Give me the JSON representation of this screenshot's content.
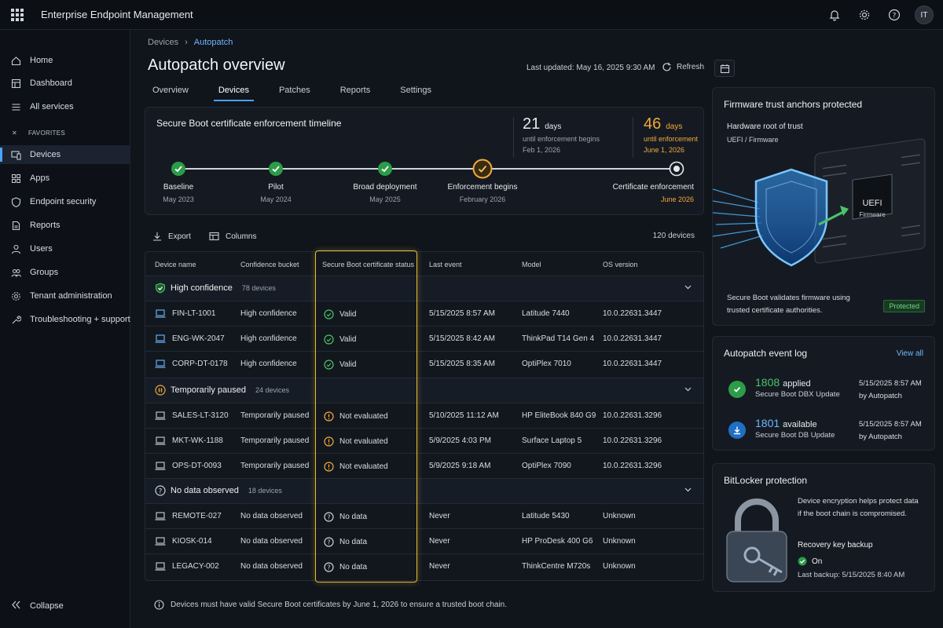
{
  "app": {
    "title": "Enterprise Endpoint Management",
    "avatar_initials": "IT"
  },
  "sidebar": {
    "items": [
      {
        "label": "Home",
        "icon": "home-icon"
      },
      {
        "label": "Dashboard",
        "icon": "dashboard-icon"
      },
      {
        "label": "All services",
        "icon": "list-icon"
      },
      {
        "label": "Devices",
        "icon": "devices-icon",
        "active": true
      },
      {
        "label": "Apps",
        "icon": "apps-icon"
      },
      {
        "label": "Endpoint security",
        "icon": "shield-icon"
      },
      {
        "label": "Reports",
        "icon": "reports-icon"
      },
      {
        "label": "Users",
        "icon": "user-icon"
      },
      {
        "label": "Groups",
        "icon": "groups-icon"
      },
      {
        "label": "Tenant administration",
        "icon": "gear-icon"
      },
      {
        "label": "Troubleshooting + support",
        "icon": "wrench-icon"
      }
    ],
    "favorites_label": "FAVORITES",
    "collapse_label": "Collapse"
  },
  "header": {
    "breadcrumb": [
      "Devices",
      "Autopatch"
    ],
    "title": "Autopatch overview",
    "last_updated": "Last updated: May 16, 2025 9:30 AM",
    "refresh_label": "Refresh",
    "tabs": [
      "Overview",
      "Devices",
      "Patches",
      "Reports",
      "Settings"
    ],
    "active_tab": "Devices"
  },
  "timeline": {
    "title": "Secure Boot certificate enforcement timeline",
    "counter1": {
      "number": "21",
      "unit": "days",
      "line1": "until enforcement begins",
      "line2": "Feb 1, 2026"
    },
    "counter2": {
      "number": "46",
      "unit": "days",
      "line1": "until enforcement",
      "line2": "June 1, 2026"
    },
    "milestones": [
      {
        "label": "Baseline",
        "date": "May 2023",
        "state": "done"
      },
      {
        "label": "Pilot",
        "date": "May 2024",
        "state": "done"
      },
      {
        "label": "Broad deployment",
        "date": "May 2025",
        "state": "done"
      },
      {
        "label": "Enforcement begins",
        "date": "February 2026",
        "state": "current"
      },
      {
        "label": "Certificate enforcement",
        "date": "June 2026",
        "state": "final"
      }
    ]
  },
  "toolbar": {
    "export_label": "Export",
    "columns_label": "Columns",
    "device_count": "120 devices"
  },
  "table": {
    "headers": [
      "Device name",
      "Confidence bucket",
      "Secure Boot certificate status",
      "Last event",
      "Model",
      "OS version"
    ],
    "groups": [
      {
        "title": "High confidence",
        "count": "78 devices",
        "icon": "shield-check-icon",
        "rows": [
          {
            "name": "FIN-LT-1001",
            "bucket": "High confidence",
            "status": "Valid",
            "event": "5/15/2025 8:57 AM",
            "model": "Latitude 7440",
            "os": "10.0.22631.3447"
          },
          {
            "name": "ENG-WK-2047",
            "bucket": "High confidence",
            "status": "Valid",
            "event": "5/15/2025 8:42 AM",
            "model": "ThinkPad T14 Gen 4",
            "os": "10.0.22631.3447"
          },
          {
            "name": "CORP-DT-0178",
            "bucket": "High confidence",
            "status": "Valid",
            "event": "5/15/2025 8:35 AM",
            "model": "OptiPlex 7010",
            "os": "10.0.22631.3447"
          }
        ]
      },
      {
        "title": "Temporarily paused",
        "count": "24 devices",
        "icon": "pause-icon",
        "rows": [
          {
            "name": "SALES-LT-3120",
            "bucket": "Temporarily paused",
            "status": "Not evaluated",
            "event": "5/10/2025 11:12 AM",
            "model": "HP EliteBook 840 G9",
            "os": "10.0.22631.3296"
          },
          {
            "name": "MKT-WK-1188",
            "bucket": "Temporarily paused",
            "status": "Not evaluated",
            "event": "5/9/2025 4:03 PM",
            "model": "Surface Laptop 5",
            "os": "10.0.22631.3296"
          },
          {
            "name": "OPS-DT-0093",
            "bucket": "Temporarily paused",
            "status": "Not evaluated",
            "event": "5/9/2025 9:18 AM",
            "model": "OptiPlex 7090",
            "os": "10.0.22631.3296"
          }
        ]
      },
      {
        "title": "No data observed",
        "count": "18 devices",
        "icon": "question-icon",
        "rows": [
          {
            "name": "REMOTE-027",
            "bucket": "No data observed",
            "status": "No data",
            "event": "Never",
            "model": "Latitude 5430",
            "os": "Unknown"
          },
          {
            "name": "KIOSK-014",
            "bucket": "No data observed",
            "status": "No data",
            "event": "Never",
            "model": "HP ProDesk 400 G6",
            "os": "Unknown"
          },
          {
            "name": "LEGACY-002",
            "bucket": "No data observed",
            "status": "No data",
            "event": "Never",
            "model": "ThinkCentre M720s",
            "os": "Unknown"
          }
        ]
      }
    ]
  },
  "footnote": "Devices must have valid Secure Boot certificates by June 1, 2026 to ensure a trusted boot chain.",
  "firmware": {
    "title": "Firmware trust anchors protected",
    "sub1": "Hardware root of trust",
    "sub2": "UEFI / Firmware",
    "chip_label1": "UEFI",
    "chip_label2": "Firmware",
    "desc": "Secure Boot validates firmware using trusted certificate authorities.",
    "badge": "Protected"
  },
  "event_log": {
    "title": "Autopatch event log",
    "view_all": "View all",
    "entries": [
      {
        "number": "1808",
        "word": "applied",
        "sub": "Secure Boot DBX Update",
        "time": "5/15/2025 8:57 AM",
        "by": "by Autopatch"
      },
      {
        "number": "1801",
        "word": "available",
        "sub": "Secure Boot DB Update",
        "time": "5/15/2025 8:57 AM",
        "by": "by Autopatch"
      }
    ]
  },
  "bitlocker": {
    "title": "BitLocker protection",
    "desc": "Device encryption helps protect data if the boot chain is compromised.",
    "key_label": "Recovery key backup",
    "state": "On",
    "last_backup": "Last backup: 5/15/2025 8:40 AM"
  },
  "colors": {
    "accent": "#4aa3ff",
    "warning": "#f2a93b",
    "success": "#4cc36a",
    "highlight": "#e5b93a"
  }
}
